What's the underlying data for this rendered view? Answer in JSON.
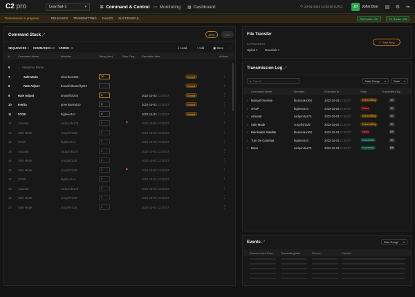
{
  "topbar": {
    "logo": "C2",
    "logo_suffix": "pro",
    "satellite": "LeanSat-1",
    "nav": [
      {
        "label": "Command & Control",
        "icon": "command-icon"
      },
      {
        "label": "Monitoring",
        "icon": "monitor-icon"
      },
      {
        "label": "Dashboard",
        "icon": "dashboard-icon"
      }
    ],
    "datetime": "23-01-2024 14:03:00 (UTC)",
    "user_initials": "JD",
    "user_name": "John Doe"
  },
  "banner": {
    "message": "Transmission in progress",
    "stages": [
      "RELEASED",
      "TRANSMITTING",
      "FAILED",
      "SUCCESSFUL"
    ],
    "ok_badges": [
      "TM Router: OK",
      "TC Router: OK"
    ]
  },
  "command_stack": {
    "title": "Command Stack",
    "arm_label": "ARM",
    "go_label": "GO",
    "tabs": [
      {
        "label": "SEQUENCES",
        "count": "2"
      },
      {
        "label": "COMMANDS",
        "count": "28"
      },
      {
        "label": "ARMED",
        "count": "23"
      }
    ],
    "toolbar": {
      "load": "Load",
      "add": "Add",
      "save": "Save"
    },
    "columns": [
      "#",
      "Command Name",
      "Identifier",
      "Delay (sec)",
      "Stop Flag",
      "Execution time",
      "Actions"
    ],
    "rows": [
      {
        "num": "6",
        "name": "Sequence Name",
        "identifier": "",
        "delay": "",
        "flag": false,
        "exec_date": "",
        "exec_time": "",
        "status": "",
        "dim": false,
        "kind": "group"
      },
      {
        "num": "7",
        "name": "Safe Mode",
        "identifier": "silverduck204",
        "delay": "20",
        "flag": false,
        "exec_date": "",
        "exec_time": "",
        "status": "Armed",
        "dim": false,
        "kind": "child",
        "delay_hl": true
      },
      {
        "num": "8",
        "name": "Rate Adjust",
        "identifier": "beautifulbutterfly202",
        "delay": "",
        "flag": false,
        "exec_date": "",
        "exec_time": "",
        "status": "Armed",
        "dim": false,
        "kind": "child"
      },
      {
        "num": "9",
        "name": "Rate Adjust",
        "identifier": "brownfish258",
        "delay": "5",
        "flag": false,
        "exec_date": "2022-10-03",
        "exec_time": "12:20:07",
        "status": "Armed",
        "dim": false,
        "delay_hl": true
      },
      {
        "num": "10",
        "name": "Inertia",
        "identifier": "greenlousia510",
        "delay": "0",
        "flag": false,
        "exec_date": "2022-10-03",
        "exec_time": "12:20:07",
        "status": "Armed",
        "dim": false
      },
      {
        "num": "11",
        "name": "STOP",
        "identifier": "bigbear444",
        "delay": "0",
        "flag": false,
        "exec_date": "2022-10-03",
        "exec_time": "12:20:07",
        "status": "Armed",
        "dim": false
      },
      {
        "num": "12",
        "name": "Actuator",
        "identifier": "sadpanda175",
        "delay": "0",
        "flag": true,
        "exec_date": "2022-10-03",
        "exec_time": "12:20:07",
        "status": "",
        "dim": true
      },
      {
        "num": "13",
        "name": "Safe Mode",
        "identifier": "crazyfish228",
        "delay": "0",
        "flag": false,
        "exec_date": "2022-10-03",
        "exec_time": "12:20:07",
        "status": "",
        "dim": true
      },
      {
        "num": "14",
        "name": "STOP",
        "identifier": "bigbear444",
        "delay": "0",
        "flag": false,
        "exec_date": "2022-10-03",
        "exec_time": "12:20:07",
        "status": "",
        "dim": true
      },
      {
        "num": "15",
        "name": "Actuator",
        "identifier": "sadpanda175",
        "delay": "0",
        "flag": false,
        "exec_date": "2022-10-03",
        "exec_time": "12:20:07",
        "status": "",
        "dim": true
      },
      {
        "num": "16",
        "name": "Safe Mode",
        "identifier": "crazyfish228",
        "delay": "0",
        "flag": false,
        "exec_date": "2022-10-03",
        "exec_time": "12:20:07",
        "status": "",
        "dim": true
      },
      {
        "num": "16",
        "name": "Safe Mode",
        "identifier": "crazyfish228",
        "delay": "0",
        "flag": true,
        "exec_date": "2022-10-03",
        "exec_time": "12:20:07",
        "status": "",
        "dim": true
      },
      {
        "num": "17",
        "name": "STOP",
        "identifier": "bigbear444",
        "delay": "0",
        "flag": false,
        "exec_date": "2022-10-03",
        "exec_time": "12:20:07",
        "status": "",
        "dim": true
      },
      {
        "num": "18",
        "name": "Actuator",
        "identifier": "sadpanda175",
        "delay": "0",
        "flag": false,
        "exec_date": "2022-10-03",
        "exec_time": "12:20:07",
        "status": "",
        "dim": true
      },
      {
        "num": "19",
        "name": "Safe Mode",
        "identifier": "crazyfish228",
        "delay": "0",
        "flag": false,
        "exec_date": "2022-10-03",
        "exec_time": "12:20:07",
        "status": "",
        "dim": true
      },
      {
        "num": "20",
        "name": "Safe Mode",
        "identifier": "crazyfish228",
        "delay": "0",
        "flag": false,
        "exec_date": "2022-10-03",
        "exec_time": "12:20:07",
        "status": "",
        "dim": true
      }
    ]
  },
  "file_transfer": {
    "title": "File Transfer",
    "in_progress_label": "IN PROGRESS",
    "uplink_label": "Uplink",
    "uplink_count": "0",
    "downlink_label": "Downlink",
    "downlink_count": "0",
    "start_new": "Start New"
  },
  "transmission_log": {
    "title": "Transmission Log",
    "search_placeholder": "Search",
    "date_range": "Date Range",
    "state": "State",
    "columns": [
      "Command Name",
      "Identifier",
      "Executed at",
      "State",
      "Transmitted By"
    ],
    "rows": [
      {
        "name": "Manual Override",
        "identifier": "bluesnake360",
        "date": "2022-10-03",
        "time": "12:20:07",
        "state": "Transmitting",
        "state_kind": "exec",
        "by": "JD"
      },
      {
        "name": "STOP",
        "identifier": "bigbear444",
        "date": "2022-10-03",
        "time": "12:20:07",
        "state": "Failed",
        "state_kind": "failed",
        "by": "JD"
      },
      {
        "name": "Actuator",
        "identifier": "sadpanda175",
        "date": "2022-10-03",
        "time": "12:20:07",
        "state": "Transmitting",
        "state_kind": "exec",
        "by": "JD"
      },
      {
        "name": "Safe Mode",
        "identifier": "crazyfish228",
        "date": "2022-10-03",
        "time": "12:20:07",
        "state": "Transmitting",
        "state_kind": "exec",
        "by": "JD"
      },
      {
        "name": "Reinitialize Satellite",
        "identifier": "bluesnake360",
        "date": "2022-10-03",
        "time": "12:20:07",
        "state": "Failed",
        "state_kind": "failed",
        "by": "KK"
      },
      {
        "name": "Turn On Cameras",
        "identifier": "bigbear444",
        "date": "2022-10-03",
        "time": "12:20:07",
        "state": "Successful",
        "state_kind": "succ",
        "by": "JD"
      },
      {
        "name": "Move",
        "identifier": "sadpanda175",
        "date": "2022-10-03",
        "time": "12:20:07",
        "state": "Successful",
        "state_kind": "succ",
        "by": "MK"
      }
    ]
  },
  "events": {
    "title": "Events",
    "date_range": "Date Range",
    "columns": [
      "Source event Time",
      "Processing time",
      "Source",
      "Content"
    ]
  }
}
